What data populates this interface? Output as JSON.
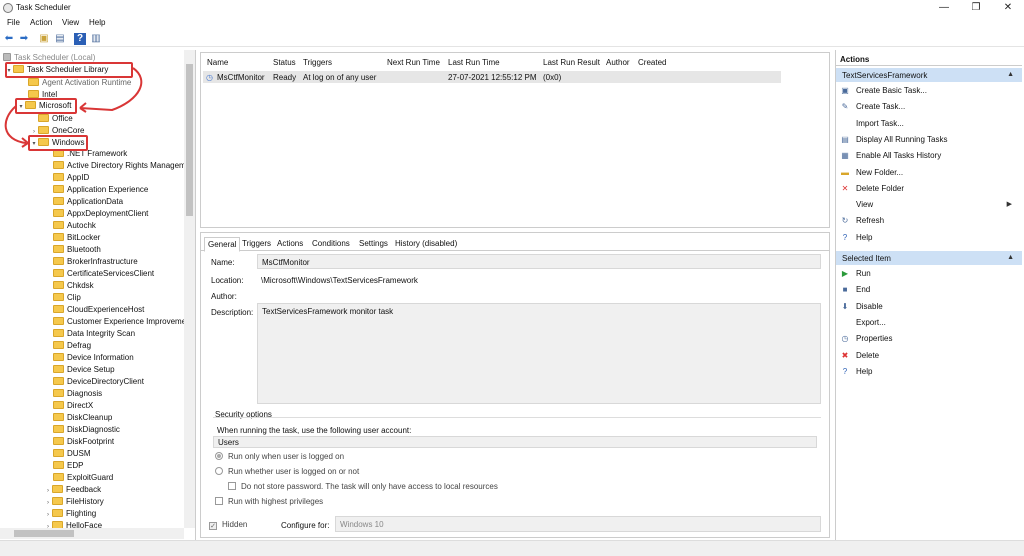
{
  "window": {
    "title": "Task Scheduler",
    "minimize": "—",
    "maximize": "❐",
    "close": "✕"
  },
  "menu": [
    "File",
    "Action",
    "View",
    "Help"
  ],
  "toolbar": {
    "back": "⬅",
    "forward": "➡",
    "folder": "▣",
    "show": "▤",
    "help": "?",
    "console": "▥"
  },
  "tree": {
    "root": "Task Scheduler (Local)",
    "library": "Task Scheduler Library",
    "agent": "Agent Activation Runtime",
    "intel": "Intel",
    "microsoft": "Microsoft",
    "office": "Office",
    "onecore": "OneCore",
    "windows": "Windows",
    "children": [
      ".NET Framework",
      "Active Directory Rights Managem",
      "AppID",
      "Application Experience",
      "ApplicationData",
      "AppxDeploymentClient",
      "Autochk",
      "BitLocker",
      "Bluetooth",
      "BrokerInfrastructure",
      "CertificateServicesClient",
      "Chkdsk",
      "Clip",
      "CloudExperienceHost",
      "Customer Experience Improvemer",
      "Data Integrity Scan",
      "Defrag",
      "Device Information",
      "Device Setup",
      "DeviceDirectoryClient",
      "Diagnosis",
      "DirectX",
      "DiskCleanup",
      "DiskDiagnostic",
      "DiskFootprint",
      "DUSM",
      "EDP",
      "ExploitGuard",
      "Feedback",
      "FileHistory",
      "Flighting",
      "HelloFace"
    ]
  },
  "tasklist": {
    "columns": [
      "Name",
      "Status",
      "Triggers",
      "Next Run Time",
      "Last Run Time",
      "Last Run Result",
      "Author",
      "Created"
    ],
    "row": {
      "name": "MsCtfMonitor",
      "status": "Ready",
      "triggers": "At log on of any user",
      "next_run": "",
      "last_run": "27-07-2021 12:55:12 PM",
      "result": "(0x0)",
      "author": "",
      "created": ""
    }
  },
  "details": {
    "tabs": [
      "General",
      "Triggers",
      "Actions",
      "Conditions",
      "Settings",
      "History (disabled)"
    ],
    "name_label": "Name:",
    "name_value": "MsCtfMonitor",
    "location_label": "Location:",
    "location_value": "\\Microsoft\\Windows\\TextServicesFramework",
    "author_label": "Author:",
    "description_label": "Description:",
    "description_value": "TextServicesFramework monitor task",
    "security_heading": "Security options",
    "run_as_text": "When running the task, use the following user account:",
    "user_account": "Users",
    "radio_logged_on": "Run only when user is logged on",
    "radio_whether": "Run whether user is logged on or not",
    "no_store_pw": "Do not store password.  The task will only have access to local resources",
    "highest_priv": "Run with highest privileges",
    "hidden": "Hidden",
    "configure_for": "Configure for:",
    "configure_value": "Windows 10"
  },
  "actions_pane": {
    "header": "Actions",
    "section1": "TextServicesFramework",
    "items1": [
      {
        "label": "Create Basic Task...",
        "icon": "▣"
      },
      {
        "label": "Create Task...",
        "icon": "✎"
      },
      {
        "label": "Import Task...",
        "icon": ""
      },
      {
        "label": "Display All Running Tasks",
        "icon": "▤"
      },
      {
        "label": "Enable All Tasks History",
        "icon": "▦"
      },
      {
        "label": "New Folder...",
        "icon": "▬"
      },
      {
        "label": "Delete Folder",
        "icon": "✕"
      },
      {
        "label": "View",
        "icon": ""
      },
      {
        "label": "Refresh",
        "icon": "↻"
      },
      {
        "label": "Help",
        "icon": "?"
      }
    ],
    "section2": "Selected Item",
    "items2": [
      {
        "label": "Run",
        "icon": "▶"
      },
      {
        "label": "End",
        "icon": "■"
      },
      {
        "label": "Disable",
        "icon": "⬇"
      },
      {
        "label": "Export...",
        "icon": ""
      },
      {
        "label": "Properties",
        "icon": "◷"
      },
      {
        "label": "Delete",
        "icon": "✖"
      },
      {
        "label": "Help",
        "icon": "?"
      }
    ]
  },
  "colors": {
    "highlight": "#d93636",
    "selection": "#cde0f5",
    "folder": "#f5c84c"
  }
}
